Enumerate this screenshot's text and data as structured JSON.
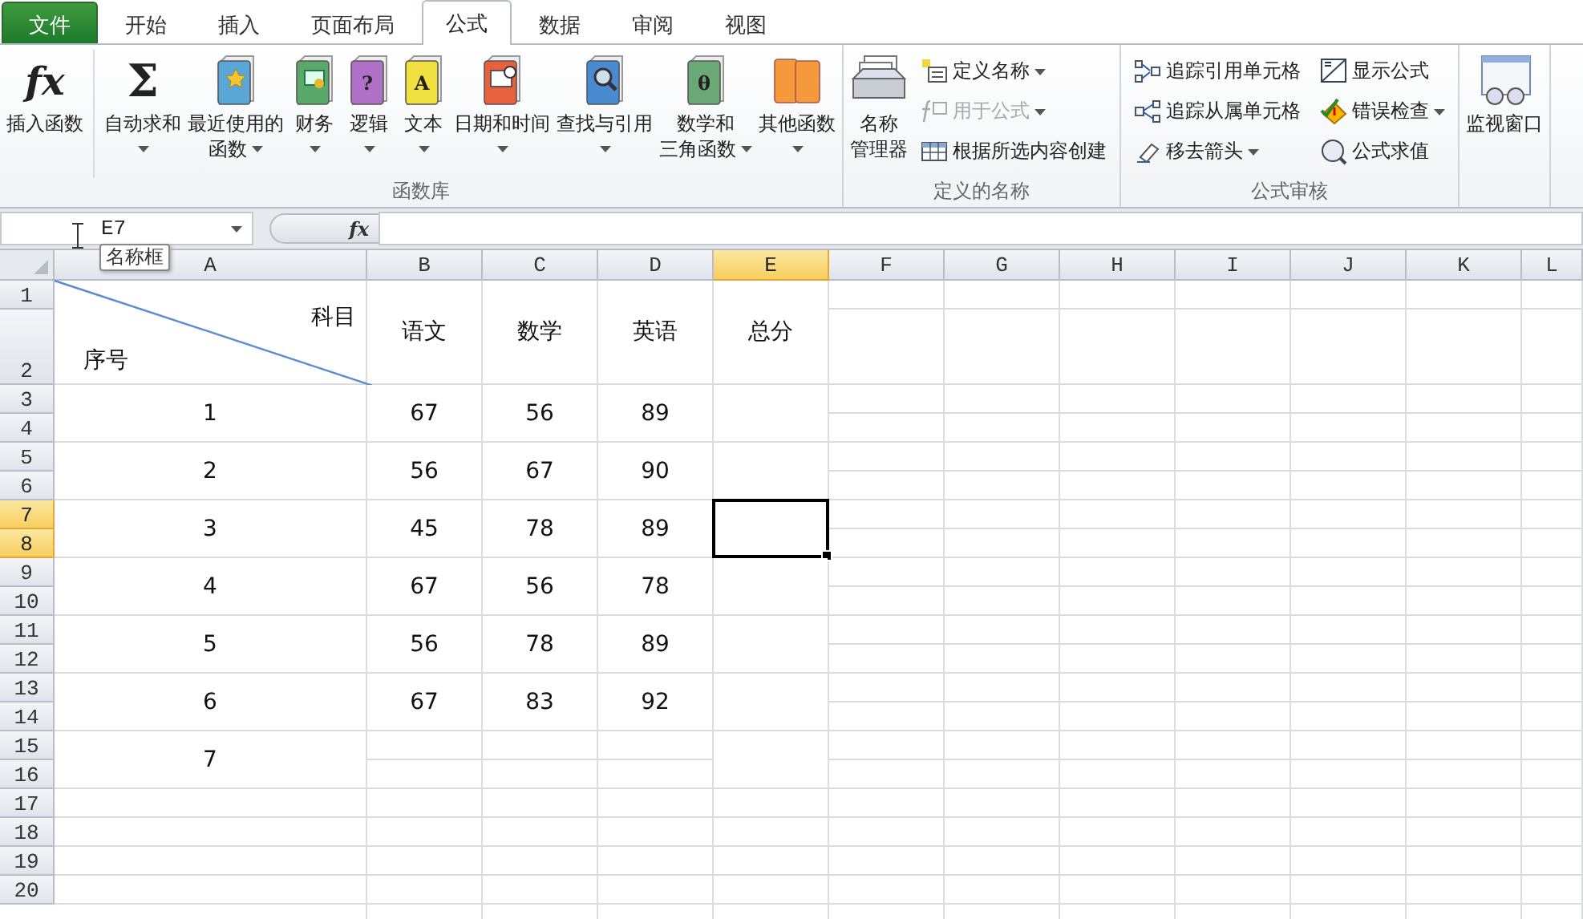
{
  "tabs": [
    {
      "label": "文件",
      "kind": "file",
      "selected": false
    },
    {
      "label": "开始",
      "kind": "tab",
      "selected": false
    },
    {
      "label": "插入",
      "kind": "tab",
      "selected": false
    },
    {
      "label": "页面布局",
      "kind": "tab",
      "selected": false
    },
    {
      "label": "公式",
      "kind": "tab",
      "selected": true
    },
    {
      "label": "数据",
      "kind": "tab",
      "selected": false
    },
    {
      "label": "审阅",
      "kind": "tab",
      "selected": false
    },
    {
      "label": "视图",
      "kind": "tab",
      "selected": false
    }
  ],
  "ribbon": {
    "groups": [
      {
        "label": "函数库",
        "items": [
          {
            "kind": "large",
            "glyph": "fx",
            "lines": [
              "插入函数"
            ],
            "dropdown": false
          },
          {
            "kind": "large",
            "glyph": "Σ",
            "lines": [
              "自动求和"
            ],
            "dropdown": true
          },
          {
            "kind": "large",
            "color": "#5aa6d6",
            "lines": [
              "最近使用的",
              "函数"
            ],
            "dropdown": true
          },
          {
            "kind": "large",
            "color": "#5aa86a",
            "lines": [
              "财务"
            ],
            "dropdown": true
          },
          {
            "kind": "large",
            "glyph": "?",
            "color": "#b070c8",
            "lines": [
              "逻辑"
            ],
            "dropdown": true
          },
          {
            "kind": "large",
            "glyph": "A",
            "color": "#f0e040",
            "lines": [
              "文本"
            ],
            "dropdown": true
          },
          {
            "kind": "large",
            "color": "#e8603c",
            "lines": [
              "日期和时间"
            ],
            "dropdown": true
          },
          {
            "kind": "large",
            "color": "#4a8ad0",
            "lines": [
              "查找与引用"
            ],
            "dropdown": true
          },
          {
            "kind": "large",
            "glyph": "θ",
            "color": "#6aa878",
            "lines": [
              "数学和",
              "三角函数"
            ],
            "dropdown": true
          },
          {
            "kind": "large",
            "color": "#f59a3a",
            "lines": [
              "其他函数"
            ],
            "dropdown": true
          }
        ]
      },
      {
        "label": "定义的名称",
        "items": [
          {
            "kind": "large",
            "lines": [
              "名称",
              "管理器"
            ],
            "dropdown": false
          },
          {
            "kind": "column",
            "buttons": [
              {
                "label": "定义名称",
                "dropdown": true,
                "disabled": false
              },
              {
                "label": "用于公式",
                "dropdown": true,
                "disabled": true
              },
              {
                "label": "根据所选内容创建",
                "dropdown": false,
                "disabled": false
              }
            ]
          }
        ]
      },
      {
        "label": "公式审核",
        "items": [
          {
            "kind": "column",
            "buttons": [
              {
                "label": "追踪引用单元格",
                "dropdown": false,
                "disabled": false
              },
              {
                "label": "追踪从属单元格",
                "dropdown": false,
                "disabled": false
              },
              {
                "label": "移去箭头",
                "dropdown": true,
                "disabled": false
              }
            ]
          },
          {
            "kind": "column",
            "buttons": [
              {
                "label": "显示公式",
                "dropdown": false,
                "disabled": false
              },
              {
                "label": "错误检查",
                "dropdown": true,
                "disabled": false
              },
              {
                "label": "公式求值",
                "dropdown": false,
                "disabled": false
              }
            ]
          }
        ]
      },
      {
        "items": [
          {
            "kind": "large",
            "lines": [
              "监视窗口"
            ],
            "dropdown": false
          }
        ]
      }
    ]
  },
  "formula_bar": {
    "name_box": "E7",
    "tooltip": "名称框",
    "fx": "fx"
  },
  "sheet": {
    "columns": [
      {
        "label": "A",
        "selected": false
      },
      {
        "label": "B",
        "selected": false
      },
      {
        "label": "C",
        "selected": false
      },
      {
        "label": "D",
        "selected": false
      },
      {
        "label": "E",
        "selected": true
      },
      {
        "label": "F",
        "selected": false
      },
      {
        "label": "G",
        "selected": false
      },
      {
        "label": "H",
        "selected": false
      },
      {
        "label": "I",
        "selected": false
      },
      {
        "label": "J",
        "selected": false
      },
      {
        "label": "K",
        "selected": false
      },
      {
        "label": "L",
        "selected": false
      }
    ],
    "rows": [
      {
        "label": "1",
        "selected": false
      },
      {
        "label": "2",
        "selected": false
      },
      {
        "label": "3",
        "selected": false
      },
      {
        "label": "4",
        "selected": false
      },
      {
        "label": "5",
        "selected": false
      },
      {
        "label": "6",
        "selected": false
      },
      {
        "label": "7",
        "selected": true
      },
      {
        "label": "8",
        "selected": true
      },
      {
        "label": "9",
        "selected": false
      },
      {
        "label": "10",
        "selected": false
      },
      {
        "label": "11",
        "selected": false
      },
      {
        "label": "12",
        "selected": false
      },
      {
        "label": "13",
        "selected": false
      },
      {
        "label": "14",
        "selected": false
      },
      {
        "label": "15",
        "selected": false
      },
      {
        "label": "16",
        "selected": false
      },
      {
        "label": "17",
        "selected": false
      },
      {
        "label": "18",
        "selected": false
      },
      {
        "label": "19",
        "selected": false
      },
      {
        "label": "20",
        "selected": false
      }
    ],
    "header": {
      "corner_top_right": "科目",
      "corner_bottom_left": "序号",
      "subjects": [
        "语文",
        "数学",
        "英语",
        "总分"
      ]
    },
    "records": [
      {
        "cells": [
          "1",
          "67",
          "56",
          "89"
        ],
        "selected": false
      },
      {
        "cells": [
          "2",
          "56",
          "67",
          "90"
        ],
        "selected": false
      },
      {
        "cells": [
          "3",
          "45",
          "78",
          "89"
        ],
        "selected": true
      },
      {
        "cells": [
          "4",
          "67",
          "56",
          "78"
        ],
        "selected": false
      },
      {
        "cells": [
          "5",
          "56",
          "78",
          "89"
        ],
        "selected": false
      },
      {
        "cells": [
          "6",
          "67",
          "83",
          "92"
        ],
        "selected": false
      },
      {
        "cells": [
          "7"
        ],
        "selected": false
      }
    ]
  }
}
